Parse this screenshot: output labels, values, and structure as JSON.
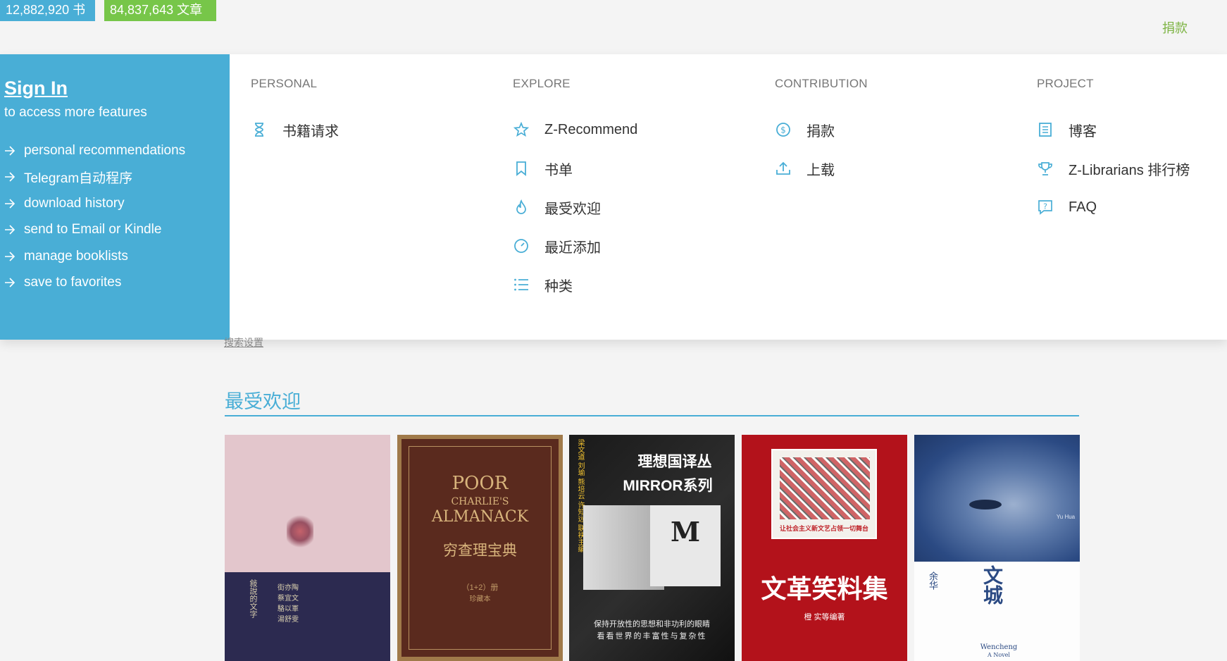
{
  "topbar": {
    "books_count": "12,882,920 书",
    "articles_count": "84,837,643 文章",
    "donate_link": "捐款"
  },
  "signin": {
    "title": "Sign In",
    "subtitle": "to access more features",
    "features": [
      "personal recommendations",
      "Telegram自动程序",
      "download history",
      "send to Email or Kindle",
      "manage booklists",
      "save to favorites"
    ]
  },
  "menu": {
    "personal": {
      "heading": "PERSONAL",
      "items": [
        {
          "label": "书籍请求",
          "icon": "hourglass-icon"
        }
      ]
    },
    "explore": {
      "heading": "EXPLORE",
      "items": [
        {
          "label": "Z-Recommend",
          "icon": "sparkle-star-icon"
        },
        {
          "label": "书单",
          "icon": "bookmark-icon"
        },
        {
          "label": "最受欢迎",
          "icon": "flame-icon"
        },
        {
          "label": "最近添加",
          "icon": "clock-icon"
        },
        {
          "label": "种类",
          "icon": "list-icon"
        }
      ]
    },
    "contribution": {
      "heading": "CONTRIBUTION",
      "items": [
        {
          "label": "捐款",
          "icon": "dollar-coin-icon"
        },
        {
          "label": "上载",
          "icon": "upload-icon"
        }
      ]
    },
    "project": {
      "heading": "PROJECT",
      "items": [
        {
          "label": "博客",
          "icon": "document-icon"
        },
        {
          "label": "Z-Librarians 排行榜",
          "icon": "trophy-icon"
        },
        {
          "label": "FAQ",
          "icon": "question-bubble-icon"
        }
      ]
    }
  },
  "hidden_link": "搜索设置",
  "popular": {
    "title": "最受欢迎",
    "books": [
      {
        "cover_lines": [
          "街亦陶",
          "蔡宜文",
          "駱以軍",
          "湯舒雯"
        ],
        "side_title": "敍說的文字"
      },
      {
        "cover_title": "POOR",
        "cover_sub1": "CHARLIE'S",
        "cover_sub2": "ALMANACK",
        "cover_cn": "穷查理宝典",
        "cover_note": "（1+2）册",
        "cover_note2": "珍藏本"
      },
      {
        "cover_title": "理想国译丛",
        "cover_sub1": "MIRROR系列",
        "cover_m": "M",
        "cover_side": "梁文道 刘瑜 熊培云 许知远 联袂主编",
        "cover_tag": "保持开放性的思想和非功利的眼睛",
        "cover_tag2": "看看世界的丰富性与复杂性"
      },
      {
        "cover_cn": "文革笑料集",
        "cover_note": "橙 实等编著",
        "cover_banner": "让社会主义新文艺占领一切舞台"
      },
      {
        "cover_cn": "文城",
        "cover_author": "余华",
        "cover_en": "Wencheng",
        "cover_en2": "A Novel",
        "cover_yu": "Yu Hua"
      }
    ]
  },
  "colors": {
    "accent": "#49aed6",
    "green": "#77c649",
    "donate_green": "#7cb342"
  }
}
